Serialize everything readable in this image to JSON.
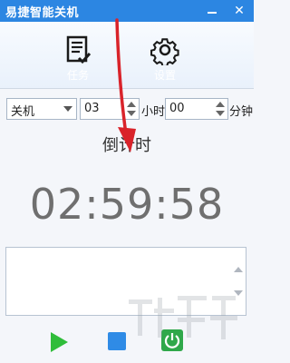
{
  "window": {
    "title": "易捷智能关机"
  },
  "toolbar": {
    "task": {
      "label": "任务",
      "icon": "task-list-icon"
    },
    "settings": {
      "label": "设置",
      "icon": "gear-icon"
    }
  },
  "controls": {
    "action_select": {
      "selected": "关机"
    },
    "hours": {
      "value": "03",
      "unit": "小时"
    },
    "minutes": {
      "value": "00",
      "unit": "分钟"
    }
  },
  "countdown": {
    "label": "倒计时",
    "time": "02:59:58"
  },
  "bottom_buttons": [
    {
      "name": "play-icon"
    },
    {
      "name": "stop-icon"
    },
    {
      "name": "power-icon"
    }
  ],
  "colors": {
    "titlebar": "#2c86e2",
    "play": "#2fbd3a",
    "stop": "#2f8be6",
    "annotation": "#d9232a"
  }
}
